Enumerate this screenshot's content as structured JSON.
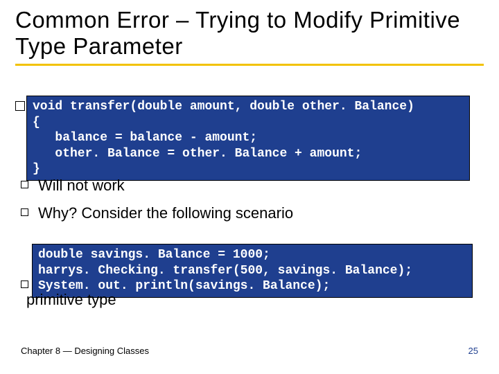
{
  "title": "Common Error – Trying to Modify Primitive Type Parameter",
  "code_block_1": "void transfer(double amount, double other. Balance)\n{\n   balance = balance - amount;\n   other. Balance = other. Balance + amount;\n}",
  "bullet_will_not_work": "Will not work",
  "bullet_why": "Why? Consider the following scenario",
  "code_block_2": "double savings. Balance = 1000;\nharrys. Checking. transfer(500, savings. Balance);\nSystem. out. println(savings. Balance);",
  "trailing_text": "primitive type",
  "footer_left": "Chapter 8 — Designing Classes",
  "footer_right": "25"
}
